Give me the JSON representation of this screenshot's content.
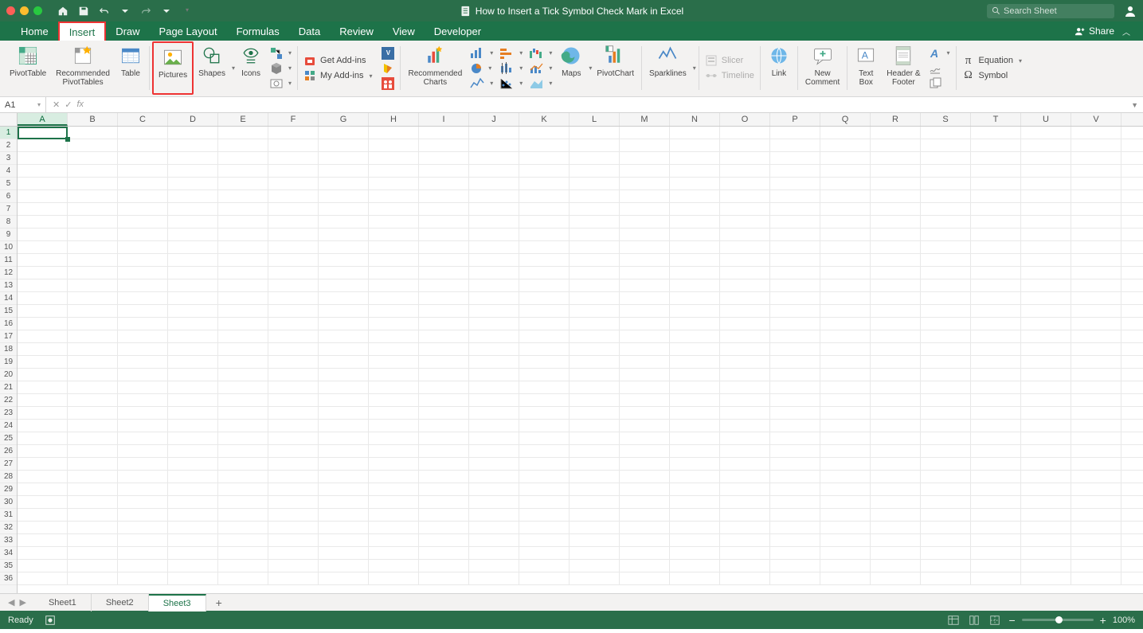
{
  "titlebar": {
    "doc_title": "How to Insert a Tick Symbol Check Mark in Excel",
    "search_placeholder": "Search Sheet"
  },
  "tabs": {
    "items": [
      "Home",
      "Insert",
      "Draw",
      "Page Layout",
      "Formulas",
      "Data",
      "Review",
      "View",
      "Developer"
    ],
    "active": "Insert",
    "share_label": "Share"
  },
  "ribbon": {
    "pivottable": "PivotTable",
    "recommended_pivots": "Recommended\nPivotTables",
    "table": "Table",
    "pictures": "Pictures",
    "shapes": "Shapes",
    "icons": "Icons",
    "get_addins": "Get Add-ins",
    "my_addins": "My Add-ins",
    "recommended_charts": "Recommended\nCharts",
    "maps": "Maps",
    "pivotchart": "PivotChart",
    "sparklines": "Sparklines",
    "slicer": "Slicer",
    "timeline": "Timeline",
    "link": "Link",
    "new_comment": "New\nComment",
    "text_box": "Text\nBox",
    "header_footer": "Header &\nFooter",
    "equation": "Equation",
    "symbol": "Symbol"
  },
  "formula_bar": {
    "name_box": "A1"
  },
  "grid": {
    "columns": [
      "A",
      "B",
      "C",
      "D",
      "E",
      "F",
      "G",
      "H",
      "I",
      "J",
      "K",
      "L",
      "M",
      "N",
      "O",
      "P",
      "Q",
      "R",
      "S",
      "T",
      "U",
      "V"
    ],
    "rows": [
      1,
      2,
      3,
      4,
      5,
      6,
      7,
      8,
      9,
      10,
      11,
      12,
      13,
      14,
      15,
      16,
      17,
      18,
      19,
      20,
      21,
      22,
      23,
      24,
      25,
      26,
      27,
      28,
      29,
      30,
      31,
      32,
      33,
      34,
      35,
      36
    ],
    "selected_cell": "A1"
  },
  "sheets": {
    "items": [
      "Sheet1",
      "Sheet2",
      "Sheet3"
    ],
    "active": "Sheet3"
  },
  "status": {
    "ready": "Ready",
    "zoom": "100%"
  }
}
